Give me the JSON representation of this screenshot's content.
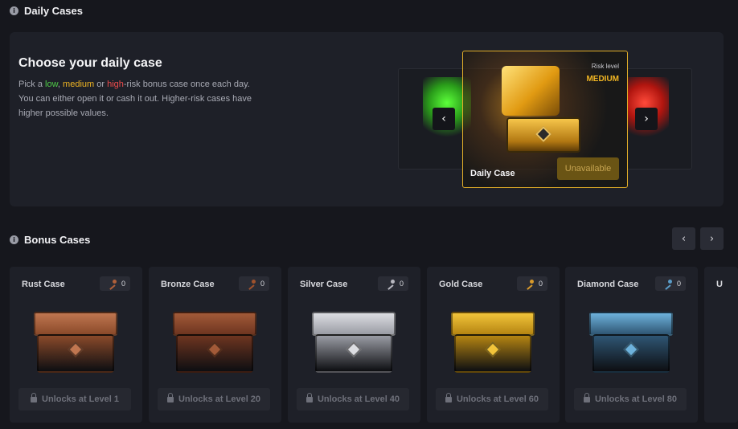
{
  "daily_section": {
    "title": "Daily Cases"
  },
  "daily_panel": {
    "heading": "Choose your daily case",
    "desc_pick": "Pick a ",
    "desc_low": "low",
    "desc_sep": ", ",
    "desc_medium": "medium",
    "desc_or": " or ",
    "desc_high": "high",
    "desc_rest": "-risk bonus case once each day. You can either open it or cash it out. Higher-risk cases have higher possible values."
  },
  "daily_card": {
    "name": "Daily Case",
    "risk_label": "Risk level",
    "risk_value": "MEDIUM",
    "button": "Unavailable"
  },
  "icons": {
    "prev": "‹",
    "next": "›",
    "info": "i"
  },
  "bonus_section": {
    "title": "Bonus Cases"
  },
  "bonus_cases": [
    {
      "name": "Rust Case",
      "keys": "0",
      "lock_text": "Unlocks at Level 1",
      "key_color": "#b0603a",
      "chest_color": "#8a4a2a",
      "chest_light": "#c07650"
    },
    {
      "name": "Bronze Case",
      "keys": "0",
      "lock_text": "Unlocks at Level 20",
      "key_color": "#a0522d",
      "chest_color": "#6e3520",
      "chest_light": "#a25a38"
    },
    {
      "name": "Silver Case",
      "keys": "0",
      "lock_text": "Unlocks at Level 40",
      "key_color": "#b8b8c0",
      "chest_color": "#9a9ca4",
      "chest_light": "#dcdde2"
    },
    {
      "name": "Gold Case",
      "keys": "0",
      "lock_text": "Unlocks at Level 60",
      "key_color": "#d99a2b",
      "chest_color": "#b58512",
      "chest_light": "#f2c43a"
    },
    {
      "name": "Diamond Case",
      "keys": "0",
      "lock_text": "Unlocks at Level 80",
      "key_color": "#5a9cc8",
      "chest_color": "#2f5674",
      "chest_light": "#6db2dc"
    }
  ],
  "partial_card": {
    "name": "U"
  }
}
